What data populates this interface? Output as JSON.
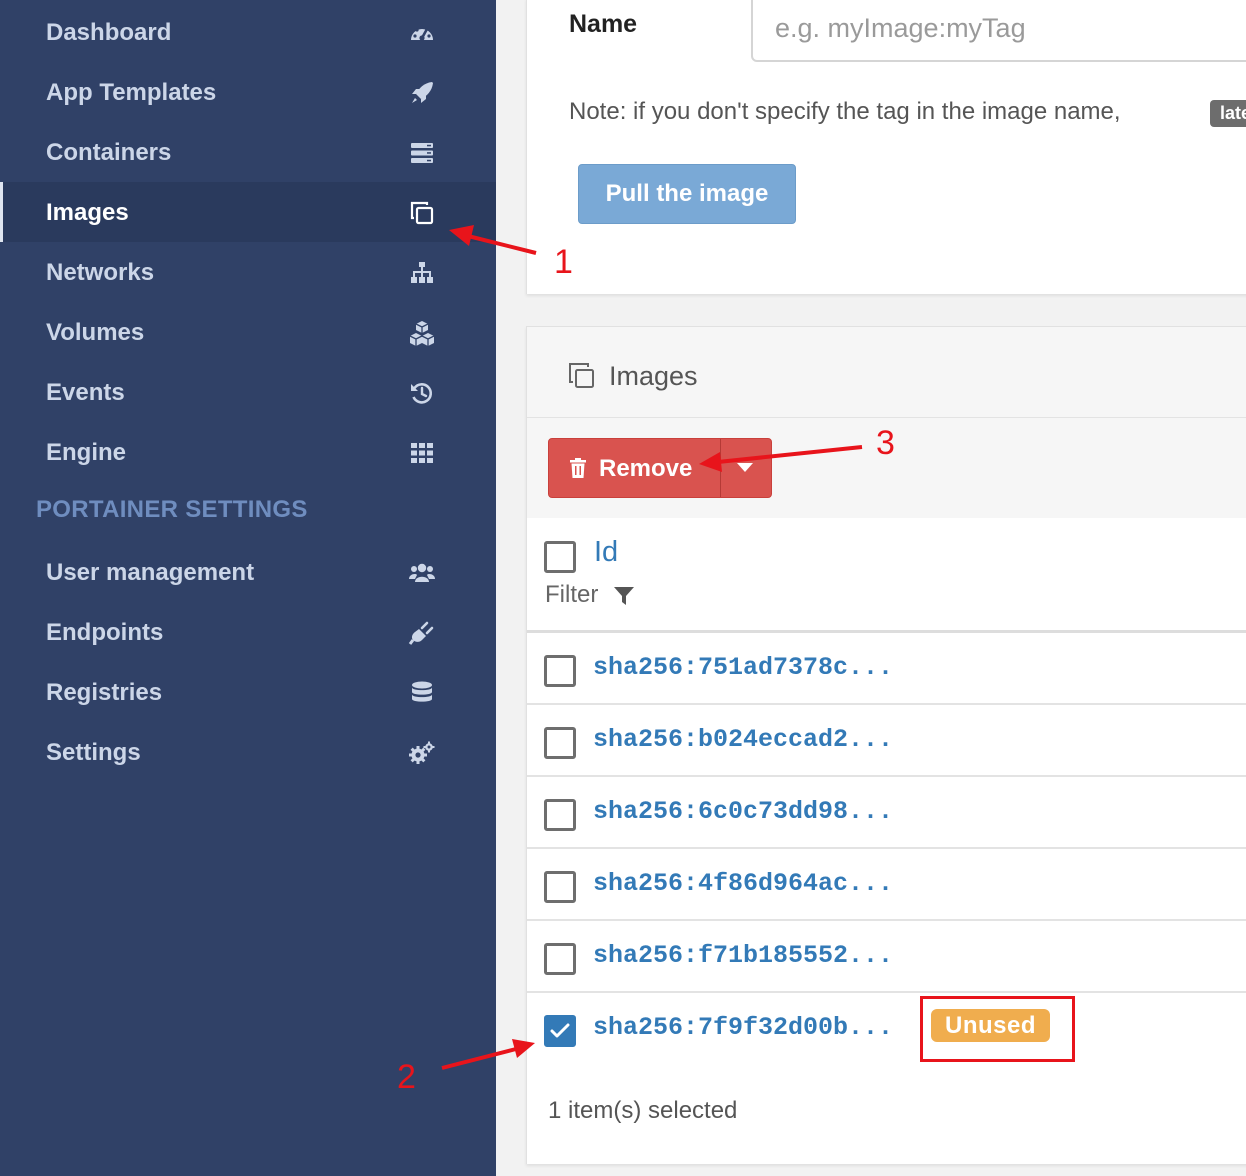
{
  "sidebar": {
    "items": [
      {
        "label": "Dashboard",
        "icon": "tachometer-icon"
      },
      {
        "label": "App Templates",
        "icon": "rocket-icon"
      },
      {
        "label": "Containers",
        "icon": "server-icon"
      },
      {
        "label": "Images",
        "icon": "clone-icon",
        "active": true
      },
      {
        "label": "Networks",
        "icon": "sitemap-icon"
      },
      {
        "label": "Volumes",
        "icon": "cubes-icon"
      },
      {
        "label": "Events",
        "icon": "history-icon"
      },
      {
        "label": "Engine",
        "icon": "th-icon"
      }
    ],
    "settings_heading": "PORTAINER SETTINGS",
    "settings_items": [
      {
        "label": "User management",
        "icon": "users-icon"
      },
      {
        "label": "Endpoints",
        "icon": "plug-icon"
      },
      {
        "label": "Registries",
        "icon": "database-icon"
      },
      {
        "label": "Settings",
        "icon": "cogs-icon"
      }
    ]
  },
  "pull_form": {
    "name_label": "Name",
    "name_placeholder": "e.g. myImage:myTag",
    "note": "Note: if you don't specify the tag in the image name,",
    "latest_badge": "latest",
    "pull_button": "Pull the image"
  },
  "images_panel": {
    "title": "Images",
    "remove_button": "Remove",
    "id_header": "Id",
    "filter_label": "Filter",
    "rows": [
      {
        "id": "sha256:751ad7378c...",
        "checked": false
      },
      {
        "id": "sha256:b024eccad2...",
        "checked": false
      },
      {
        "id": "sha256:6c0c73dd98...",
        "checked": false
      },
      {
        "id": "sha256:4f86d964ac...",
        "checked": false
      },
      {
        "id": "sha256:f71b185552...",
        "checked": false
      },
      {
        "id": "sha256:7f9f32d00b...",
        "checked": true,
        "badge": "Unused"
      }
    ],
    "selection_status": "1 item(s) selected"
  },
  "annotations": {
    "labels": [
      "1",
      "2",
      "3"
    ],
    "color": "#e8141b"
  },
  "colors": {
    "sidebar_bg": "#304167",
    "link_blue": "#337ab7",
    "danger": "#d9534f",
    "warning": "#f0ad4e",
    "primary_light": "#7aa9d6"
  }
}
